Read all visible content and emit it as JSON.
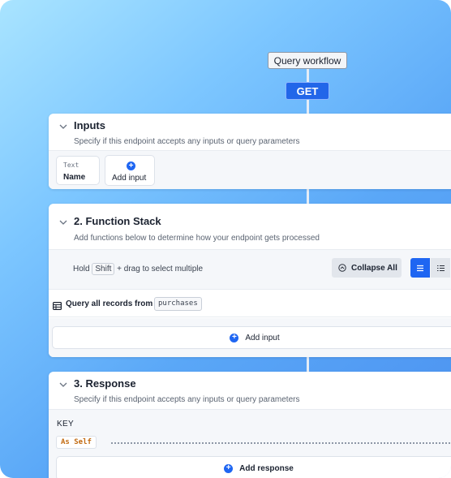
{
  "workflow": {
    "title": "Query workflow",
    "method": "GET"
  },
  "inputs": {
    "title": "Inputs",
    "subtitle": "Specify if this endpoint accepts any inputs or query parameters",
    "field": {
      "type": "Text",
      "name": "Name"
    },
    "add_label": "Add input"
  },
  "function_stack": {
    "title": "2. Function Stack",
    "subtitle": "Add functions below to determine how your endpoint gets processed",
    "hint_hold": "Hold",
    "hint_key": "Shift",
    "hint_rest": "+ drag to select multiple",
    "collapse_label": "Collapse All",
    "query_label": "Query all records from",
    "query_table": "purchases",
    "add_label": "Add input"
  },
  "response": {
    "title": "3. Response",
    "subtitle": "Specify if this endpoint accepts any inputs or query parameters",
    "key_header": "KEY",
    "key_value": "As Self",
    "add_label": "Add response"
  },
  "colors": {
    "accent": "#1f66f2",
    "gradient_start": "#a9e4ff",
    "gradient_end": "#4a90f0",
    "key_value_text": "#c26b12"
  },
  "icons": [
    "chevron-down-icon",
    "plus-circle-icon",
    "collapse-icon",
    "list-view-icon",
    "list-indent-icon",
    "table-icon"
  ]
}
